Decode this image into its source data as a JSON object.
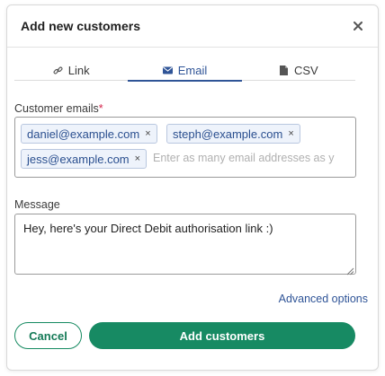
{
  "dialog": {
    "title": "Add new customers",
    "close_icon": "close-icon"
  },
  "tabs": [
    {
      "label": "Link",
      "icon": "link-icon",
      "active": false
    },
    {
      "label": "Email",
      "icon": "envelope-icon",
      "active": true
    },
    {
      "label": "CSV",
      "icon": "file-icon",
      "active": false
    }
  ],
  "emails": {
    "label": "Customer emails",
    "required_marker": "*",
    "chips": [
      "daniel@example.com",
      "steph@example.com",
      "jess@example.com"
    ],
    "chip_remove_glyph": "×",
    "placeholder": "Enter as many email addresses as y"
  },
  "message": {
    "label": "Message",
    "value": "Hey, here's your Direct Debit authorisation link :)"
  },
  "advanced_link": "Advanced options",
  "actions": {
    "cancel_label": "Cancel",
    "submit_label": "Add customers"
  },
  "colors": {
    "accent_blue": "#2f5497",
    "primary_green": "#178a63",
    "required_red": "#d4264c"
  }
}
